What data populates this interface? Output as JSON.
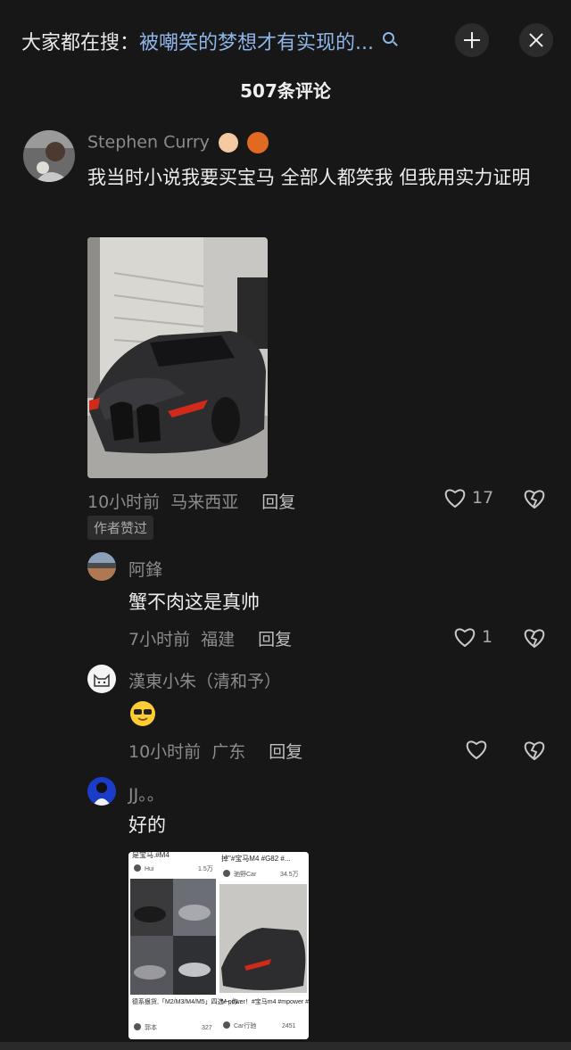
{
  "header": {
    "search_prefix": "大家都在搜：",
    "search_topic": "被嘲笑的梦想才有实现的...",
    "comment_count": "507条评论"
  },
  "comments": [
    {
      "username": "Stephen Curry",
      "text": "我当时小说我要买宝马 全部人都笑我 但我用实力证明",
      "time": "10小时前",
      "location": "马来西亚",
      "reply": "回复",
      "likes": "17",
      "badge": "作者赞过"
    },
    {
      "username": "阿鋒",
      "text": "蟹不肉这是真帅",
      "time": "7小时前",
      "location": "福建",
      "reply": "回复",
      "likes": "1"
    },
    {
      "username": "漢東小朱（清和予）",
      "text": "",
      "time": "10小时前",
      "location": "广东",
      "reply": "回复",
      "likes": ""
    },
    {
      "username": "JJ。。",
      "text": "好的"
    }
  ],
  "embedded_screenshot": {
    "left_card_top": "是宝马.#M4",
    "left_card_user": "Hui",
    "left_card_likes": "1.5万",
    "left_card_caption": "德系狠货,「M2/M3/M4/M5」四选一,你...",
    "left_card_author": "郭本",
    "left_card_count": "327",
    "right_card_top": "掉\"#宝马M4 #G82 #...",
    "right_card_user": "驰野Car",
    "right_card_likes": "34.5万",
    "right_card_caption": "M power！#宝马m4 #mpower #dou是好...",
    "right_card_author": "Car行驰",
    "right_card_count": "2451"
  },
  "colors": {
    "background": "#171717",
    "topic_link": "#8fb6e8",
    "muted": "#8b8b8b"
  }
}
